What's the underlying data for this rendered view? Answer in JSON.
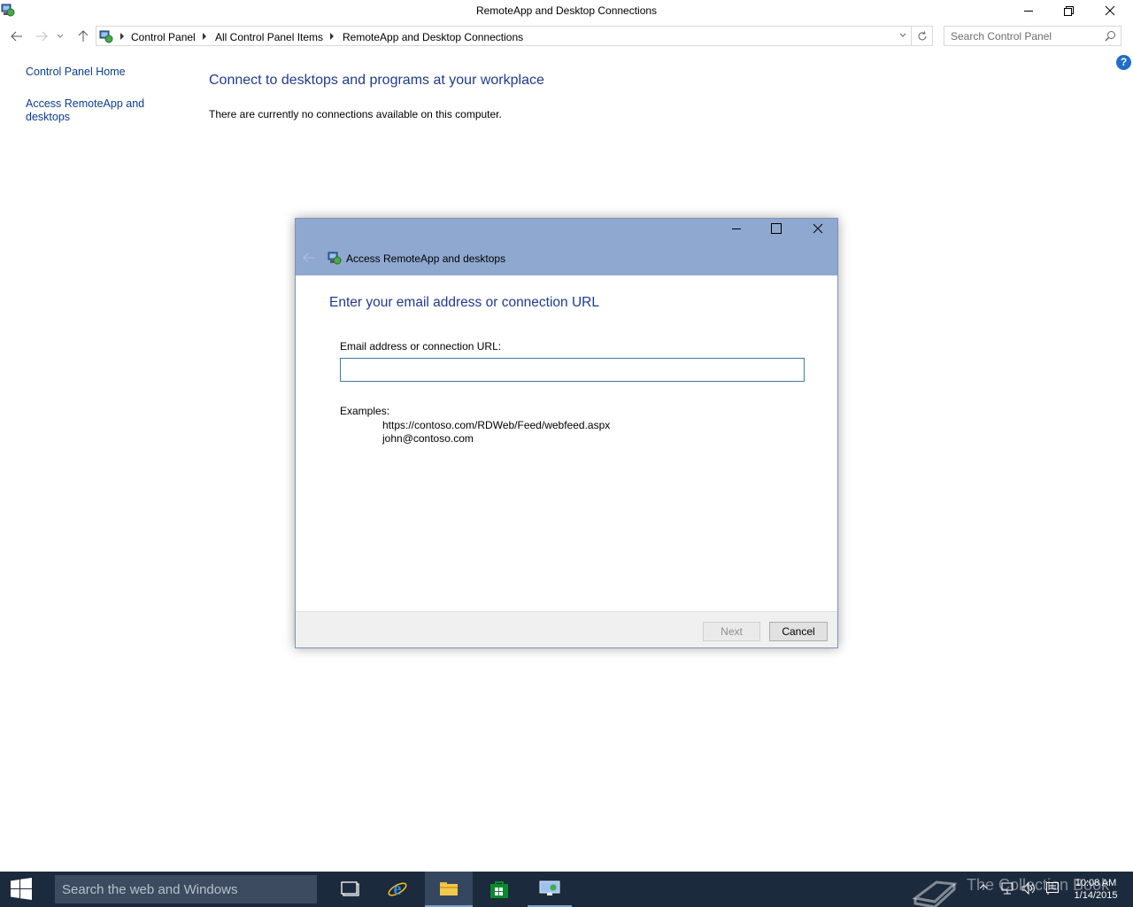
{
  "window": {
    "title": "RemoteApp and Desktop Connections"
  },
  "breadcrumb": [
    "Control Panel",
    "All Control Panel Items",
    "RemoteApp and Desktop Connections"
  ],
  "search": {
    "placeholder": "Search Control Panel"
  },
  "sidebar": {
    "items": [
      {
        "label": "Control Panel Home"
      },
      {
        "label": "Access RemoteApp and desktops"
      }
    ]
  },
  "main": {
    "heading": "Connect to desktops and programs at your workplace",
    "status": "There are currently no connections available on this computer."
  },
  "dialog": {
    "title": "Access RemoteApp and desktops",
    "heading": "Enter your email address or connection URL",
    "field_label": "Email address or connection URL:",
    "field_value": "",
    "examples_label": "Examples:",
    "examples": [
      "https://contoso.com/RDWeb/Feed/webfeed.aspx",
      "john@contoso.com"
    ],
    "next_label": "Next",
    "cancel_label": "Cancel"
  },
  "taskbar": {
    "search_placeholder": "Search the web and Windows",
    "watermark": "The Collection Book",
    "time": "10:08 AM",
    "date": "1/14/2015"
  },
  "colors": {
    "link": "#0b3d91",
    "heading": "#1e3b8f",
    "dialog_header": "#8fa8cf",
    "taskbar": "#1c2a3d"
  },
  "icons": [
    "control-panel-icon",
    "back-arrow-icon",
    "forward-arrow-icon",
    "up-arrow-icon",
    "refresh-icon",
    "search-icon",
    "help-icon",
    "minimize-icon",
    "maximize-icon",
    "restore-icon",
    "close-icon",
    "windows-logo-icon",
    "file-explorer-icon",
    "internet-explorer-icon",
    "store-icon",
    "remote-desktop-icon"
  ]
}
